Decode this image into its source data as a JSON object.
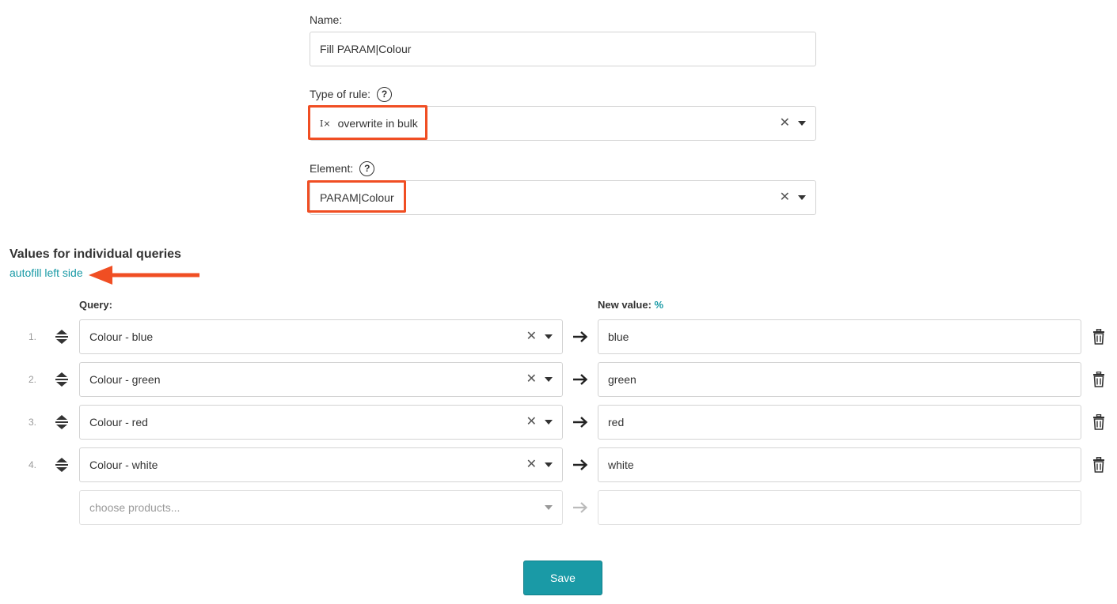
{
  "form": {
    "name_label": "Name:",
    "name_value": "Fill PARAM|Colour",
    "type_label": "Type of rule:",
    "type_icon_glyph": "I×",
    "type_value": "overwrite in bulk",
    "element_label": "Element:",
    "element_value": "PARAM|Colour",
    "help_glyph": "?",
    "clear_glyph": "✕"
  },
  "values_section": {
    "title": "Values for individual queries",
    "autofill_link": "autofill left side",
    "query_header": "Query:",
    "new_value_header": "New value:",
    "new_value_header_suffix": "%"
  },
  "rows": [
    {
      "num": "1.",
      "query": "Colour - blue",
      "value": "blue"
    },
    {
      "num": "2.",
      "query": "Colour - green",
      "value": "green"
    },
    {
      "num": "3.",
      "query": "Colour - red",
      "value": "red"
    },
    {
      "num": "4.",
      "query": "Colour - white",
      "value": "white"
    }
  ],
  "new_row": {
    "placeholder": "choose products..."
  },
  "actions": {
    "save_label": "Save"
  },
  "colors": {
    "accent": "#1a9aa6",
    "highlight": "#f04e23",
    "border": "#d3d3d3"
  },
  "icons": [
    "help-icon",
    "text-format-icon",
    "clear-icon",
    "dropdown-caret-icon",
    "drag-handle-icon",
    "arrow-right-icon",
    "trash-icon"
  ]
}
